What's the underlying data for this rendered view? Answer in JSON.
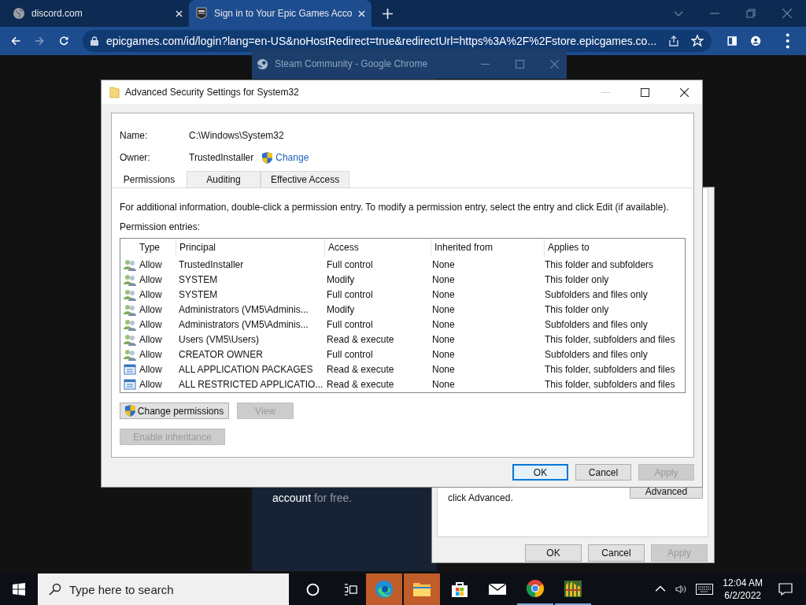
{
  "browser": {
    "tabs": [
      {
        "title": "discord.com",
        "kind": "globe",
        "selected": false
      },
      {
        "title": "Sign in to Your Epic Games Acco",
        "kind": "epic",
        "selected": true
      }
    ],
    "address": "epicgames.com/id/login?lang=en-US&noHostRedirect=true&redirectUrl=https%3A%2F%2Fstore.epicgames.co..."
  },
  "steam_window": {
    "title": "Steam Community - Google Chrome",
    "text": "**account** for free."
  },
  "back_dialog": {
    "text": "click Advanced.",
    "advanced_button": "Advanced",
    "buttons": [
      {
        "label": "OK",
        "disabled": false
      },
      {
        "label": "Cancel",
        "disabled": false
      },
      {
        "label": "Apply",
        "disabled": true
      }
    ]
  },
  "dialog": {
    "title": "Advanced Security Settings for System32",
    "name_label": "Name:",
    "name": "C:\\Windows\\System32",
    "owner_label": "Owner:",
    "owner": "TrustedInstaller",
    "change_link": "Change",
    "tabs": [
      {
        "label": "Permissions",
        "selected": true
      },
      {
        "label": "Auditing",
        "selected": false
      },
      {
        "label": "Effective Access",
        "selected": false
      }
    ],
    "info": "For additional information, double-click a permission entry. To modify a permission entry, select the entry and click Edit (if available).",
    "entries_label": "Permission entries:",
    "columns": [
      "Type",
      "Principal",
      "Access",
      "Inherited from",
      "Applies to"
    ],
    "rows": [
      {
        "kind": "user",
        "cells": [
          "Allow",
          "TrustedInstaller",
          "Full control",
          "None",
          "This folder and subfolders"
        ]
      },
      {
        "kind": "user",
        "cells": [
          "Allow",
          "SYSTEM",
          "Modify",
          "None",
          "This folder only"
        ]
      },
      {
        "kind": "user",
        "cells": [
          "Allow",
          "SYSTEM",
          "Full control",
          "None",
          "Subfolders and files only"
        ]
      },
      {
        "kind": "user",
        "cells": [
          "Allow",
          "Administrators (VM5\\Adminis...",
          "Modify",
          "None",
          "This folder only"
        ]
      },
      {
        "kind": "user",
        "cells": [
          "Allow",
          "Administrators (VM5\\Adminis...",
          "Full control",
          "None",
          "Subfolders and files only"
        ]
      },
      {
        "kind": "user",
        "cells": [
          "Allow",
          "Users (VM5\\Users)",
          "Read & execute",
          "None",
          "This folder, subfolders and files"
        ]
      },
      {
        "kind": "user",
        "cells": [
          "Allow",
          "CREATOR OWNER",
          "Full control",
          "None",
          "Subfolders and files only"
        ]
      },
      {
        "kind": "package",
        "cells": [
          "Allow",
          "ALL APPLICATION PACKAGES",
          "Read & execute",
          "None",
          "This folder, subfolders and files"
        ]
      },
      {
        "kind": "package",
        "cells": [
          "Allow",
          "ALL RESTRICTED APPLICATIO...",
          "Read & execute",
          "None",
          "This folder, subfolders and files"
        ]
      }
    ],
    "actions": [
      {
        "label": "Change permissions",
        "shield": true,
        "disabled": false
      },
      {
        "label": "View",
        "shield": false,
        "disabled": true
      }
    ],
    "inheritance_button": {
      "label": "Enable inheritance",
      "disabled": true
    },
    "buttons": [
      {
        "label": "OK",
        "default": true,
        "disabled": false
      },
      {
        "label": "Cancel",
        "default": false,
        "disabled": false
      },
      {
        "label": "Apply",
        "default": false,
        "disabled": true
      }
    ]
  },
  "taskbar": {
    "search_placeholder": "Type here to search",
    "apps": [
      {
        "kind": "edge",
        "highlighted": true,
        "running": false
      },
      {
        "kind": "folder",
        "highlighted": true,
        "running": false
      },
      {
        "kind": "store",
        "highlighted": false,
        "running": false
      },
      {
        "kind": "mail",
        "highlighted": false,
        "running": false
      },
      {
        "kind": "chrome",
        "highlighted": false,
        "running": true
      },
      {
        "kind": "avg",
        "highlighted": false,
        "running": true
      }
    ],
    "time": "12:04 AM",
    "date": "6/2/2022"
  }
}
